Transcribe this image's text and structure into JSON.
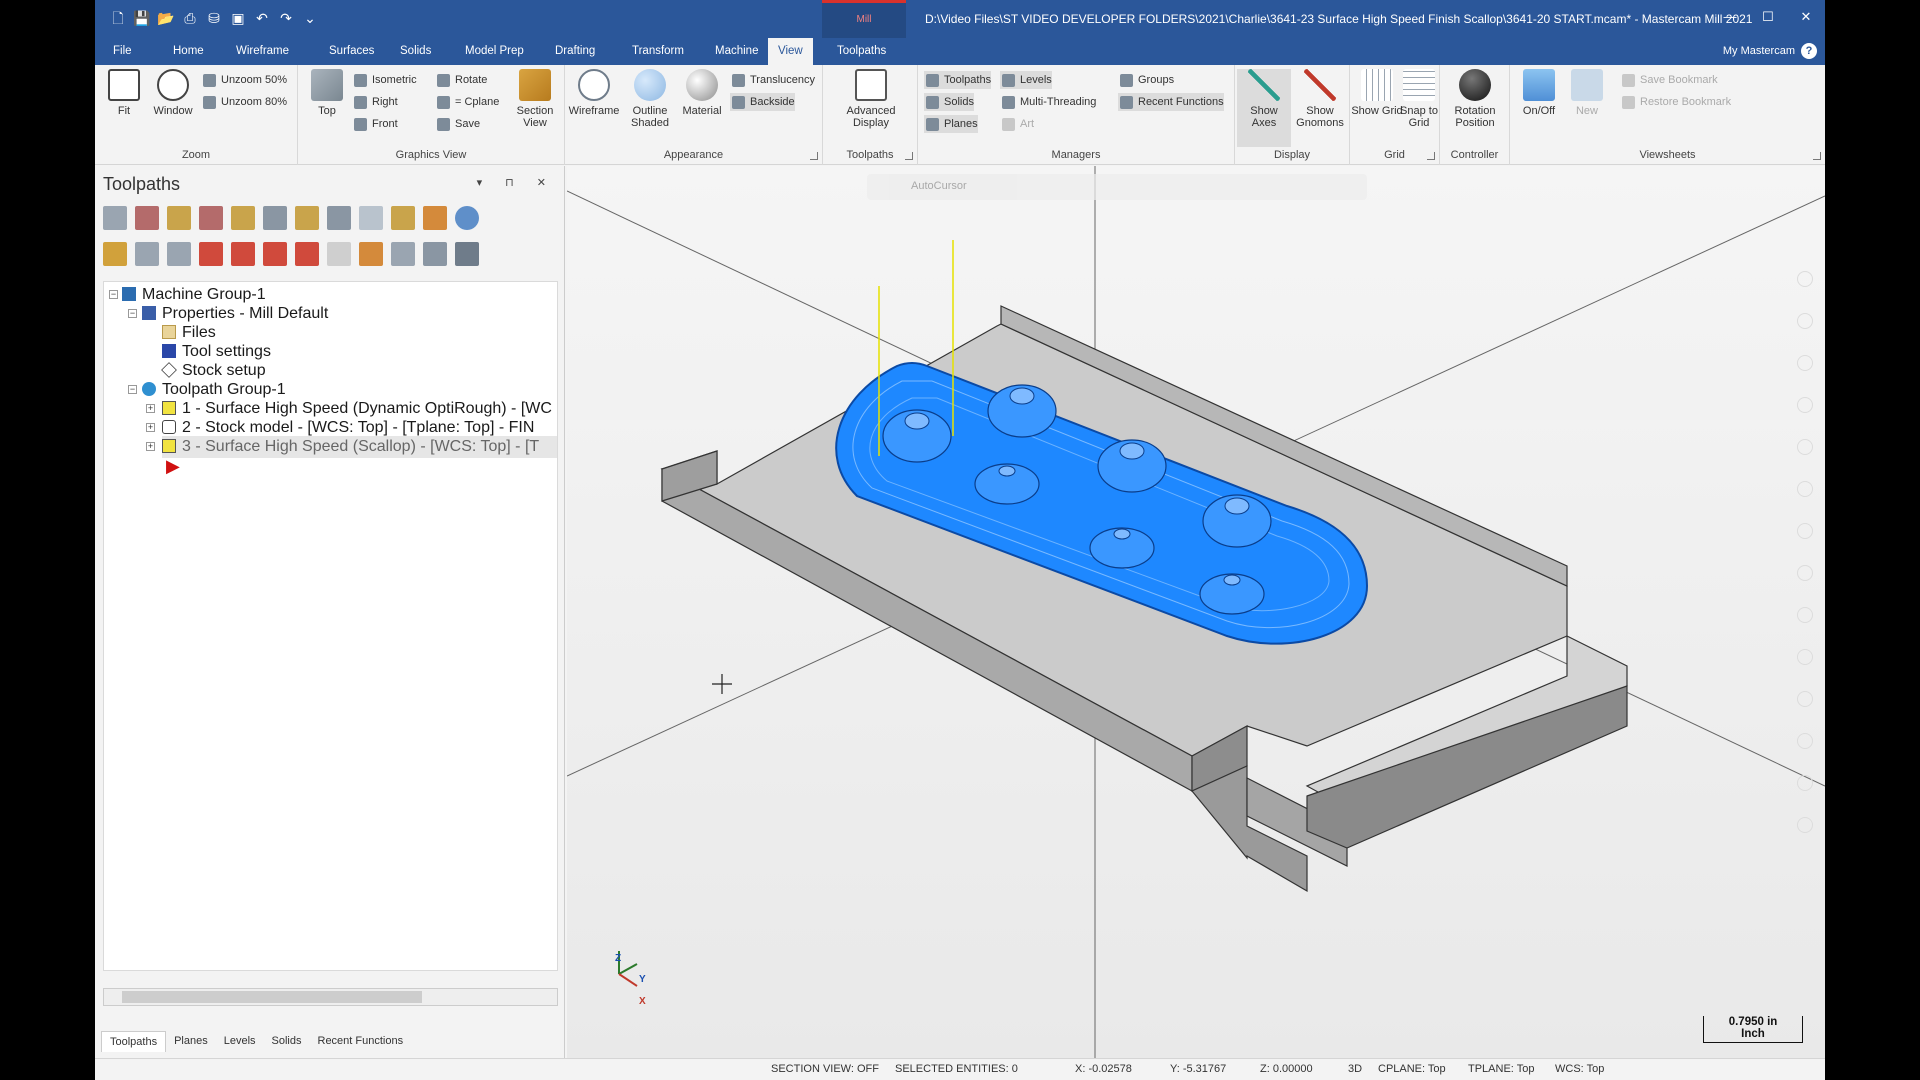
{
  "title": {
    "file_path": "D:\\Video Files\\ST VIDEO DEVELOPER FOLDERS\\2021\\Charlie\\3641-23 Surface High Speed Finish Scallop\\3641-20 START.mcam* - Mastercam Mill 2021",
    "context_tab": "Mill"
  },
  "menu": {
    "tabs": [
      "File",
      "Home",
      "Wireframe",
      "Surfaces",
      "Solids",
      "Model Prep",
      "Drafting",
      "Transform",
      "Machine",
      "View",
      "Toolpaths"
    ],
    "active": "View",
    "account": "My Mastercam"
  },
  "ribbon": {
    "zoom": {
      "label": "Zoom",
      "fit": "Fit",
      "window": "Window",
      "unzoom50": "Unzoom 50%",
      "unzoom80": "Unzoom 80%"
    },
    "graphics_view": {
      "label": "Graphics View",
      "top": "Top",
      "isometric": "Isometric",
      "right": "Right",
      "front": "Front",
      "rotate": "Rotate",
      "cplane": "= Cplane",
      "save": "Save",
      "section": "Section View"
    },
    "appearance": {
      "label": "Appearance",
      "wireframe": "Wireframe",
      "outline": "Outline Shaded",
      "material": "Material",
      "translucency": "Translucency",
      "backside": "Backside"
    },
    "toolpaths": {
      "label": "Toolpaths",
      "advanced": "Advanced Display"
    },
    "managers": {
      "label": "Managers",
      "toolpaths": "Toolpaths",
      "solids": "Solids",
      "planes": "Planes",
      "levels": "Levels",
      "multithreading": "Multi-Threading",
      "art": "Art",
      "groups": "Groups",
      "recent": "Recent Functions"
    },
    "display": {
      "label": "Display",
      "show_axes": "Show Axes",
      "show_gnomons": "Show Gnomons"
    },
    "grid": {
      "label": "Grid",
      "show_grid": "Show Grid",
      "snap": "Snap to Grid"
    },
    "controller": {
      "label": "Controller",
      "rotation": "Rotation Position"
    },
    "viewsheets": {
      "label": "Viewsheets",
      "onoff": "On/Off",
      "new": "New",
      "save_bm": "Save Bookmark",
      "restore_bm": "Restore Bookmark"
    }
  },
  "panel": {
    "title": "Toolpaths",
    "tree": [
      {
        "label": "Machine Group-1"
      },
      {
        "label": "Properties - Mill Default"
      },
      {
        "label": "Files"
      },
      {
        "label": "Tool settings"
      },
      {
        "label": "Stock setup"
      },
      {
        "label": "Toolpath Group-1"
      },
      {
        "label": "1 - Surface High Speed (Dynamic OptiRough) - [WC"
      },
      {
        "label": "2 - Stock model - [WCS: Top] - [Tplane: Top] - FIN"
      },
      {
        "label": "3 - Surface High Speed (Scallop) - [WCS: Top] - [T"
      }
    ],
    "bottom_tabs": [
      "Toolpaths",
      "Planes",
      "Levels",
      "Solids",
      "Recent Functions"
    ]
  },
  "viewport": {
    "autocursor": "AutoCursor",
    "scale_value": "0.7950 in",
    "scale_unit": "Inch",
    "axis_z": "Z",
    "axis_y": "Y",
    "axis_x": "X"
  },
  "status": {
    "section_view": "SECTION VIEW: OFF",
    "selected": "SELECTED ENTITIES: 0",
    "x": "X:   -0.02578",
    "y": "Y:   -5.31767",
    "z": "Z:   0.00000",
    "mode": "3D",
    "cplane": "CPLANE: Top",
    "tplane": "TPLANE: Top",
    "wcs": "WCS: Top"
  },
  "colors": {
    "titlebar": "#2b579a",
    "toolpath_blue": "#1e88ff",
    "part_gray": "#c8c8c8"
  }
}
